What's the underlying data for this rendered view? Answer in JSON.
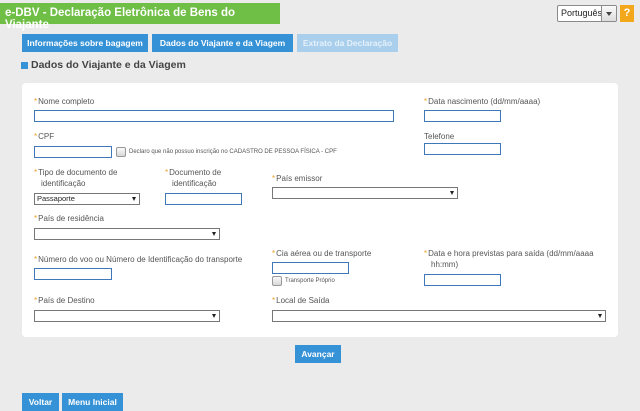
{
  "header": {
    "title": "e-DBV - Declaração Eletrônica de Bens do Viajante",
    "language": "Português",
    "help": "?"
  },
  "tabs": [
    {
      "label": "Informações sobre bagagem"
    },
    {
      "label": "Dados do Viajante e da Viagem"
    },
    {
      "label": "Extrato da Declaração"
    }
  ],
  "section": {
    "title": "Dados do Viajante e da Viagem"
  },
  "form": {
    "required_mark": "*",
    "nome_label": "Nome completo",
    "nascimento_label": "Data nascimento (dd/mm/aaaa)",
    "cpf_label": "CPF",
    "cpf_checkbox_label": "Declaro que não possuo inscrição no CADASTRO DE PESSOA FÍSICA - CPF",
    "telefone_label": "Telefone",
    "tipo_doc_label_1": "Tipo de documento de",
    "tipo_doc_label_2": "identificação",
    "tipo_doc_value": "Passaporte",
    "doc_label_1": "Documento de",
    "doc_label_2": "identificação",
    "pais_emissor_label": "País emissor",
    "pais_residencia_label": "País de residência",
    "voo_label": "Número do voo ou Número de Identificação do transporte",
    "cia_label": "Cia aérea ou de transporte",
    "transporte_proprio_label": "Transporte Próprio",
    "saida_label_1": "Data e hora previstas para saída (dd/mm/aaaa",
    "saida_label_2": "hh:mm)",
    "destino_label": "País de Destino",
    "local_saida_label": "Local de Saída"
  },
  "buttons": {
    "avancar": "Avançar",
    "voltar": "Voltar",
    "menu": "Menu Inicial"
  }
}
